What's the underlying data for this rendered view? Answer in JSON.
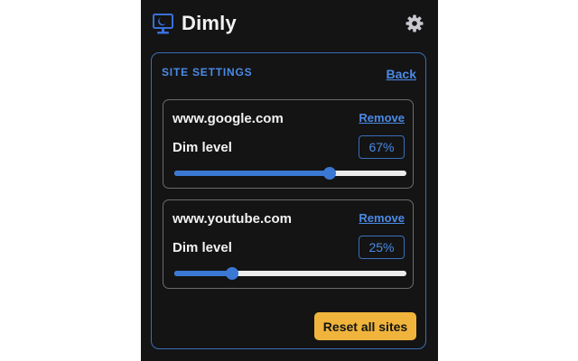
{
  "app": {
    "title": "Dimly",
    "logo_icon": "monitor-moon-icon",
    "settings_icon": "gear-icon"
  },
  "panel": {
    "title": "SITE SETTINGS",
    "back_label": "Back",
    "sites": [
      {
        "domain": "www.google.com",
        "remove_label": "Remove",
        "dim_label": "Dim level",
        "dim_value": 67,
        "dim_display": "67%"
      },
      {
        "domain": "www.youtube.com",
        "remove_label": "Remove",
        "dim_label": "Dim level",
        "dim_value": 25,
        "dim_display": "25%"
      }
    ],
    "reset_label": "Reset all sites"
  },
  "colors": {
    "background": "#141414",
    "accent": "#4a8ae6",
    "slider_fill": "#3a78d4",
    "reset_button": "#f0b43c"
  }
}
